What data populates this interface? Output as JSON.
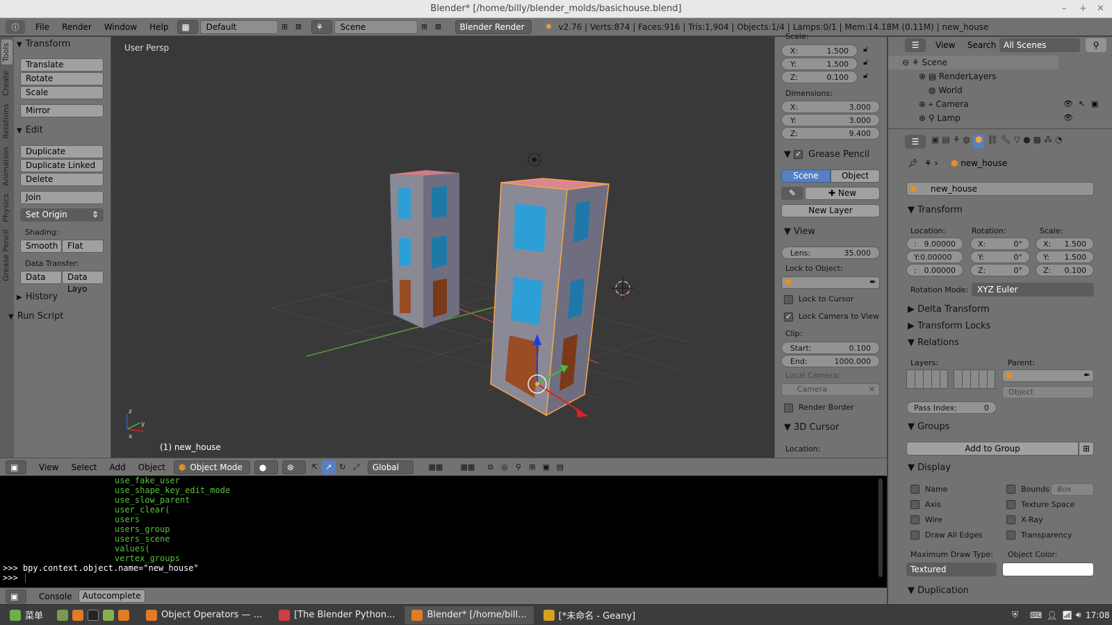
{
  "window": {
    "title": "Blender* [/home/billy/blender_molds/basichouse.blend]",
    "controls": [
      "–",
      "+",
      "✕"
    ]
  },
  "infobar": {
    "menus": [
      "File",
      "Render",
      "Window",
      "Help"
    ],
    "screen_layout": "Default",
    "scene": "Scene",
    "engine": "Blender Render",
    "stats": "v2.76 | Verts:874 | Faces:916 | Tris:1,904 | Objects:1/4 | Lamps:0/1 | Mem:14.18M (0.11M) | new_house"
  },
  "toolshelf": {
    "tabs": [
      "Tools",
      "Create",
      "Relations",
      "Animation",
      "Physics",
      "Grease Pencil"
    ],
    "transform": {
      "header": "Transform",
      "buttons": [
        "Translate",
        "Rotate",
        "Scale",
        "Mirror"
      ]
    },
    "edit": {
      "header": "Edit",
      "buttons": [
        "Duplicate",
        "Duplicate Linked",
        "Delete",
        "Join"
      ],
      "set_origin": "Set Origin"
    },
    "shading": {
      "label": "Shading:",
      "smooth": "Smooth",
      "flat": "Flat"
    },
    "data_transfer": {
      "label": "Data Transfer:",
      "data": "Data",
      "data_layout": "Data Layo"
    },
    "history": "History",
    "run_script": "Run Script"
  },
  "viewport": {
    "label": "User Persp",
    "object_label": "(1) new_house"
  },
  "npanel": {
    "scale_label": "Scale:",
    "scale": {
      "x": "1.500",
      "y": "1.500",
      "z": "0.100"
    },
    "dimensions_label": "Dimensions:",
    "dimensions": {
      "x": "3.000",
      "y": "3.000",
      "z": "9.400"
    },
    "grease_pencil": {
      "header": "Grease Pencil",
      "scene": "Scene",
      "object": "Object",
      "new": "New",
      "new_layer": "New Layer"
    },
    "view": {
      "header": "View",
      "lens_label": "Lens:",
      "lens": "35.000",
      "lock_to_object": "Lock to Object:",
      "lock_to_cursor": "Lock to Cursor",
      "lock_camera": "Lock Camera to View",
      "clip_label": "Clip:",
      "start_label": "Start:",
      "start": "0.100",
      "end_label": "End:",
      "end": "1000.000",
      "local_camera": "Local Camera:",
      "camera": "Camera",
      "render_border": "Render Border"
    },
    "cursor": {
      "header": "3D Cursor",
      "location": "Location:"
    }
  },
  "view3d_header": {
    "menus": [
      "View",
      "Select",
      "Add",
      "Object"
    ],
    "mode": "Object Mode",
    "orientation": "Global"
  },
  "console": {
    "suggestions": [
      "use_fake_user",
      "use_shape_key_edit_mode",
      "use_slow_parent",
      "user_clear(",
      "users",
      "users_group",
      "users_scene",
      "values(",
      "vertex_groups"
    ],
    "command": ">>> bpy.context.object.name=\"new_house\"",
    "prompt": ">>> "
  },
  "console_header": {
    "console": "Console",
    "autocomplete": "Autocomplete"
  },
  "outliner": {
    "menus": [
      "View",
      "Search"
    ],
    "filter": "All Scenes",
    "tree": [
      "Scene",
      "RenderLayers",
      "World",
      "Camera",
      "Lamp"
    ]
  },
  "properties": {
    "breadcrumb": "new_house",
    "object_name": "new_house",
    "transform": {
      "header": "Transform",
      "location_label": "Location:",
      "rotation_label": "Rotation:",
      "scale_label": "Scale:",
      "location": [
        "9.00000",
        "Y:0.00000",
        "0.00000"
      ],
      "rotation": [
        "0°",
        "0°",
        "0°"
      ],
      "scale": [
        "1.500",
        "1.500",
        "0.100"
      ],
      "rotation_mode_label": "Rotation Mode:",
      "rotation_mode": "XYZ Euler"
    },
    "delta_transform": "Delta Transform",
    "transform_locks": "Transform Locks",
    "relations": {
      "header": "Relations",
      "layers": "Layers:",
      "parent": "Parent:",
      "parent_type": "Object",
      "pass_index_label": "Pass Index:",
      "pass_index": "0"
    },
    "groups": {
      "header": "Groups",
      "add": "Add to Group"
    },
    "display": {
      "header": "Display",
      "name": "Name",
      "axis": "Axis",
      "wire": "Wire",
      "draw_all_edges": "Draw All Edges",
      "bounds": "Bounds",
      "bounds_type": "Box",
      "texture_space": "Texture Space",
      "xray": "X-Ray",
      "transparency": "Transparency",
      "max_draw_type_label": "Maximum Draw Type:",
      "max_draw_type": "Textured",
      "object_color_label": "Object Color:"
    },
    "duplication": "Duplication"
  },
  "taskbar": {
    "start": "菜单",
    "tasks": [
      "Object Operators — ...",
      "[The Blender Python...",
      "Blender* [/home/bill...",
      "[*未命名 - Geany]"
    ],
    "clock": "17:08"
  },
  "colors": {
    "accent_blue": "#5680c2",
    "selection_orange": "#f5a44c",
    "window_blue": "#2e9fd6",
    "door_brown": "#9a4c24",
    "roof_pink": "#d9868e"
  }
}
